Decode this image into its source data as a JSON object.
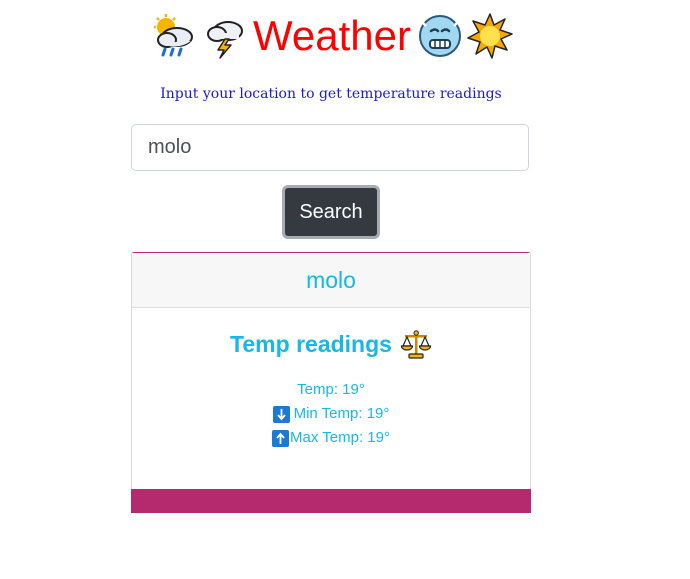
{
  "header": {
    "title": "Weather",
    "icons": [
      "sun-behind-rain-cloud-icon",
      "lightning-cloud-icon",
      "cold-face-icon",
      "glowing-sun-icon"
    ],
    "title_color": "#ff0000"
  },
  "subtitle": "Input your location to get temperature readings",
  "search": {
    "value": "molo",
    "button_label": "Search"
  },
  "card": {
    "location": "molo",
    "readings_title": "Temp readings",
    "readings_icon": "balance-scale-icon",
    "temp": "Temp: 19°",
    "min_temp": " Min Temp: 19°",
    "max_temp": "Max Temp: 19°",
    "accent_color": "#b5296f",
    "text_color": "#17b8e6"
  }
}
